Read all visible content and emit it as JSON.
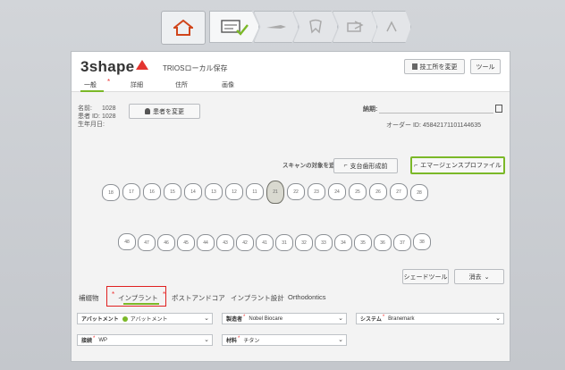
{
  "workflow": {
    "steps": [
      "home",
      "order-form",
      "scan",
      "design",
      "send",
      "done"
    ]
  },
  "header": {
    "brand": "3shape",
    "app_name": "TRIOSローカル保存",
    "change_lab_button": "技工所を変更",
    "tools_button": "ツール"
  },
  "tabs": [
    "一般",
    "詳細",
    "住所",
    "画像"
  ],
  "patient": {
    "name_label": "名前:",
    "name_value": "1028",
    "id_label": "患者 ID:",
    "id_value": "1028",
    "dob_label": "生年月日:",
    "change_patient_button": "患者を変更",
    "due_label": "納期:",
    "order_id": "オーダー ID: 45842171101144635"
  },
  "scan_controls": {
    "add_scan_label": "スキャンの対象を追加:",
    "antagonist_button": "支台歯形成前",
    "emergence_button": "エマージェンスプロファイル"
  },
  "teeth": {
    "upper": [
      "18",
      "17",
      "16",
      "15",
      "14",
      "13",
      "12",
      "11",
      "21",
      "22",
      "23",
      "24",
      "25",
      "26",
      "27",
      "28"
    ],
    "lower": [
      "48",
      "47",
      "46",
      "45",
      "44",
      "43",
      "42",
      "41",
      "31",
      "32",
      "33",
      "34",
      "35",
      "36",
      "37",
      "38"
    ],
    "implant_tooth": "21"
  },
  "shade_tool_button": "シェードツール",
  "delete_button": "消去",
  "subtabs": [
    "補綴物",
    "インプラント",
    "ポストアンドコア",
    "インプラント設計",
    "Orthodontics"
  ],
  "selected_subtab": "インプラント",
  "form": {
    "abutment_label": "アバットメント",
    "abutment_value": "アバットメント",
    "manufacturer_label": "製造者",
    "manufacturer_value": "Nobel Biocare",
    "system_label": "システム",
    "system_value": "Branemark",
    "connection_label": "接続",
    "connection_value": "WP",
    "material_label": "材料",
    "material_value": "チタン"
  },
  "colors": {
    "accent": "#7bb828",
    "required": "#e33333",
    "highlight": "#e02020",
    "brand_triangle": "#e3342f"
  }
}
